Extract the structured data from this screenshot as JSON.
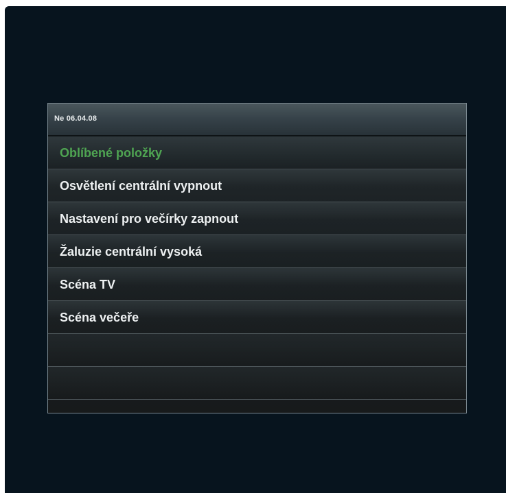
{
  "status_bar": {
    "date": "Ne 06.04.08"
  },
  "list": {
    "header": "Oblíbené položky",
    "items": [
      {
        "label": "Osvětlení centrální vypnout"
      },
      {
        "label": "Nastavení pro večírky zapnout"
      },
      {
        "label": "Žaluzie centrální vysoká"
      },
      {
        "label": "Scéna TV"
      },
      {
        "label": "Scéna večeře"
      },
      {
        "label": ""
      },
      {
        "label": ""
      }
    ]
  },
  "colors": {
    "background": "#07141e",
    "header_text": "#4fa552",
    "item_text": "#eef1f2"
  }
}
